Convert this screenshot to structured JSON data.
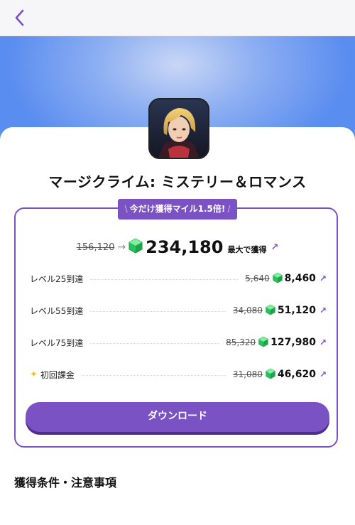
{
  "colors": {
    "accent": "#7b52c4",
    "accent_dark": "#4d2e8a",
    "gem_green": "#27c25a",
    "hero_blue": "#5a8df0",
    "sparkle_yellow": "#f2c218"
  },
  "header": {
    "back_icon": "chevron-left-icon"
  },
  "app": {
    "title": "マージクライム: ミステリー＆ロマンス",
    "icon": "app-icon-character-portrait"
  },
  "promo": {
    "badge_left": "\\",
    "badge_text": "今だけ獲得マイル1.5倍!",
    "badge_right": "/"
  },
  "total": {
    "old_value": "156,120",
    "new_value": "234,180",
    "suffix": "最大で獲得",
    "arrow": "→",
    "ext": "↗"
  },
  "rewards": [
    {
      "label": "レベル25到達",
      "old": "5,640",
      "new": "8,460",
      "ext": "↗"
    },
    {
      "label": "レベル55到達",
      "old": "34,080",
      "new": "51,120",
      "ext": "↗"
    },
    {
      "label": "レベル75到達",
      "old": "85,320",
      "new": "127,980",
      "ext": "↗"
    },
    {
      "label": "初回課金",
      "old": "31,080",
      "new": "46,620",
      "ext": "↗",
      "icon": "sparkle-icon",
      "sparkle": "✦"
    }
  ],
  "download_label": "ダウンロード",
  "section": {
    "title": "獲得条件・注意事項"
  }
}
